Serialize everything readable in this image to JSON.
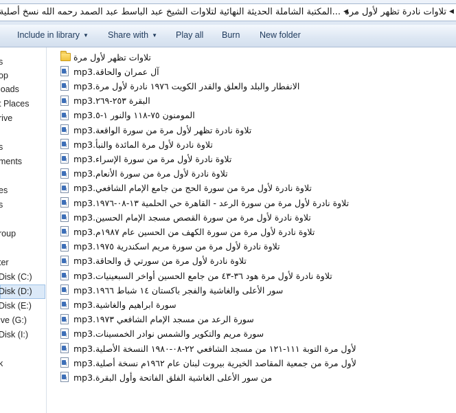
{
  "address_bar": {
    "segments": [
      "تلاوات نادرة تظهر لأول مره",
      "...المكتبة الشاملة الحديثة النهائية لتلاوات الشيخ عبد الباسط عبد الصمد رحمه الله نسخ أصلية (محد"
    ]
  },
  "toolbar": {
    "include_in_library": "Include in library",
    "share_with": "Share with",
    "play_all": "Play all",
    "burn": "Burn",
    "new_folder": "New folder"
  },
  "nav": {
    "items": [
      "s",
      "op",
      "loads",
      "t Places",
      "rive",
      "s",
      "ments",
      "es",
      "s",
      "roup",
      "ter",
      "Disk (C:)",
      "Disk (D:)",
      "Disk (E:)",
      "ive (G:)",
      "Disk (I:)",
      "k"
    ],
    "selected_index": 12
  },
  "files": [
    {
      "name": "تلاوات تظهر لأول مرة",
      "type": "folder"
    },
    {
      "name": "آل عمران والحاقة.mp3",
      "type": "mp3"
    },
    {
      "name": "الانفطار والبلد والعلق والقدر  الكويت ١٩٧٦ نادرة لأول مرة.mp3",
      "type": "mp3"
    },
    {
      "name": "البقرة ٢٥٣-٢٦٩.mp3",
      "type": "mp3"
    },
    {
      "name": "المومنون ٧٥-١١٨ والنور ١-٥.mp3",
      "type": "mp3"
    },
    {
      "name": "تلاوة نادرة تظهر لأول مرة من سورة الواقعة.mp3",
      "type": "mp3"
    },
    {
      "name": "تلاوة نادرة لأول مرة المائدة والنبأ.mp3",
      "type": "mp3"
    },
    {
      "name": "تلاوة نادرة لأول مرة من سورة الإسراء.mp3",
      "type": "mp3"
    },
    {
      "name": "تلاوة نادرة لأول مرة من سورة الأنعام.mp3",
      "type": "mp3"
    },
    {
      "name": "تلاوة نادرة لأول مرة من سورة الحج من جامع الإمام الشافعي.mp3",
      "type": "mp3"
    },
    {
      "name": "تلاوة نادرة لأول مرة من سورة الرعد - القاهرة حي الحلمية ١٣-٠٨-١٩٧٦.mp3",
      "type": "mp3"
    },
    {
      "name": "تلاوة نادرة لأول مرة من سورة القصص مسجد الإمام الحسين.mp3",
      "type": "mp3"
    },
    {
      "name": "تلاوة نادرة لأول مرة من سورة الكهف من الحسين عام ١٩٨٧م.mp3",
      "type": "mp3"
    },
    {
      "name": "تلاوة نادرة لأول مرة من سورة مريم اسكندرية ١٩٧٥.mp3",
      "type": "mp3"
    },
    {
      "name": "تلاوة نادرة لأول مرة من سورتي ق والحاقة.mp3",
      "type": "mp3"
    },
    {
      "name": "تلاوة نادرة لأول مرة هود ٣٦-٤٣ من جامع الحسين أواخر السبعينيات.mp3",
      "type": "mp3"
    },
    {
      "name": "سور الأعلى والغاشية والفجر باكستان ١٤ شباط ١٩٦٦.mp3",
      "type": "mp3"
    },
    {
      "name": "سورة ابراهيم والغاشية.mp3",
      "type": "mp3"
    },
    {
      "name": "سورة الرعد من مسجد الإمام الشافعي ١٩٧٣.mp3",
      "type": "mp3"
    },
    {
      "name": "سورة مريم والتكوير والشمس نوادر الخمسينات.mp3",
      "type": "mp3"
    },
    {
      "name": "لأول مرة التوبة ١١١-١٢١ من مسجد الشافعي ٢٢-٠٨-١٩٨٠ النسخة الأصلية.mp3",
      "type": "mp3"
    },
    {
      "name": "لأول مرة من جمعية المقاصد الخيرية بيروت لبنان عام ١٩٦٢م  نسخة أصلية.mp3",
      "type": "mp3"
    },
    {
      "name": "من سور الأعلى الغاشية الفلق الفاتحة وأول البقرة.mp3",
      "type": "mp3"
    }
  ]
}
